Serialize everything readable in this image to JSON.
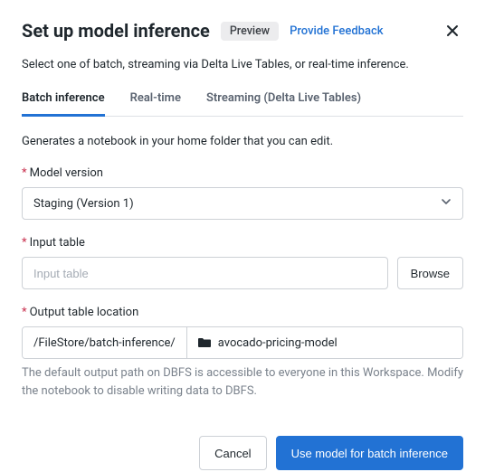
{
  "header": {
    "title": "Set up model inference",
    "badge": "Preview",
    "feedback_link": "Provide Feedback"
  },
  "intro": "Select one of batch, streaming via Delta Live Tables, or real-time inference.",
  "tabs": [
    {
      "label": "Batch inference",
      "active": true
    },
    {
      "label": "Real-time",
      "active": false
    },
    {
      "label": "Streaming (Delta Live Tables)",
      "active": false
    }
  ],
  "tab_desc": "Generates a notebook in your home folder that you can edit.",
  "form": {
    "model_version": {
      "label": "Model version",
      "value": "Staging (Version 1)"
    },
    "input_table": {
      "label": "Input table",
      "placeholder": "Input table",
      "browse": "Browse"
    },
    "output_table": {
      "label": "Output table location",
      "prefix": "/FileStore/batch-inference/",
      "value": "avocado-pricing-model",
      "hint": "The default output path on DBFS is accessible to everyone in this Workspace. Modify the notebook to disable writing data to DBFS."
    }
  },
  "footer": {
    "cancel": "Cancel",
    "submit": "Use model for batch inference"
  }
}
